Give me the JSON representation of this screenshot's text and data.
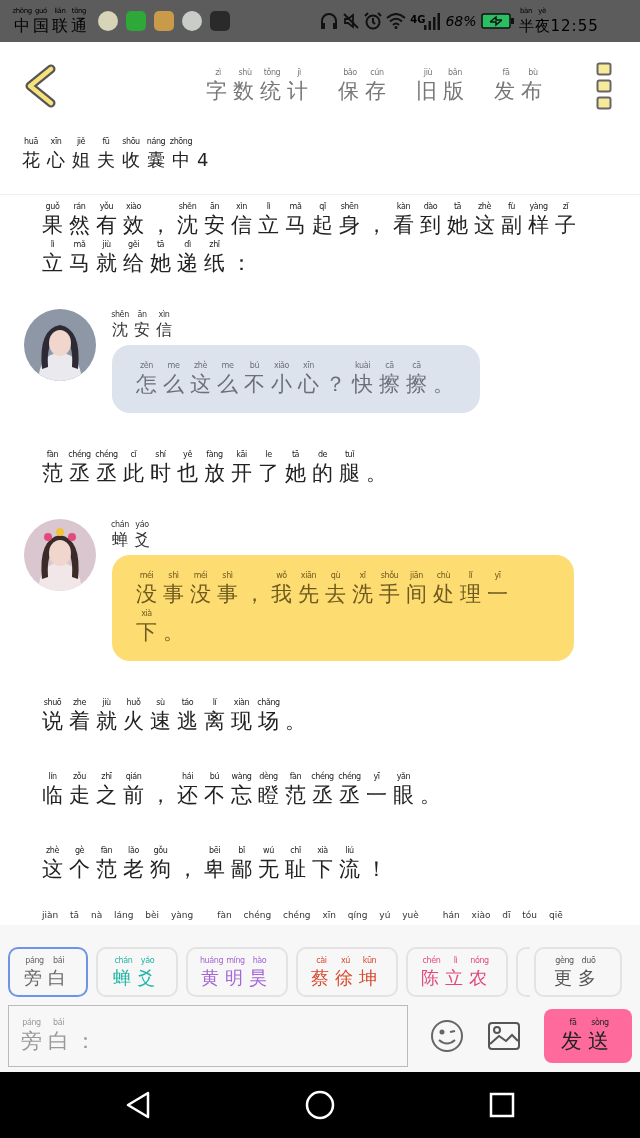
{
  "status_bar": {
    "carrier": {
      "text": "中国联通",
      "pinyin": "zhōng guó lián tōng"
    },
    "network": "4G",
    "battery": "68%",
    "time": {
      "text": "半夜12:55",
      "pinyin": "bàn yè"
    }
  },
  "header": {
    "actions": [
      {
        "text": "字数统计",
        "pinyin": "zì shù tǒng jì"
      },
      {
        "text": "保存",
        "pinyin": "bǎo cún"
      },
      {
        "text": "旧版",
        "pinyin": "jiù bǎn"
      },
      {
        "text": "发布",
        "pinyin": "fā bù"
      }
    ]
  },
  "title": {
    "text": "花心姐夫收囊中4",
    "pinyin": "huā xīn jiě fū shōu náng zhōng"
  },
  "story": [
    {
      "kind": "narration",
      "lines": [
        {
          "text": "果然有效，沈安信立马起身，看到她这副样子",
          "pinyin": "guǒ rán yǒu xiào shěn ān xìn lì mǎ qǐ shēn kàn dào tā zhè fù yàng zǐ"
        },
        {
          "text": "立马就给她递纸：",
          "pinyin": "lì mǎ jiù gěi tā dì zhǐ"
        }
      ]
    },
    {
      "kind": "message",
      "speaker": {
        "text": "沈安信",
        "pinyin": "shěn ān xìn"
      },
      "color": "#dde3ec",
      "lines": [
        {
          "text": "怎么这么不小心？快擦擦。",
          "pinyin": "zěn me zhè me bú xiǎo xīn kuài cā cā"
        }
      ]
    },
    {
      "kind": "narration",
      "lines": [
        {
          "text": "范丞丞此时也放开了她的腿。",
          "pinyin": "fàn chéng chéng cǐ shí yě fàng kāi le tā de tuǐ"
        }
      ]
    },
    {
      "kind": "message",
      "speaker": {
        "text": "蝉爻",
        "pinyin": "chán yáo"
      },
      "color": "#fddc72",
      "lines": [
        {
          "text": "没事没事，我先去洗手间处理一",
          "pinyin": "méi shì méi shì wǒ xiān qù xǐ shǒu jiān chù lǐ yī"
        },
        {
          "text": "下。",
          "pinyin": "xià"
        }
      ]
    },
    {
      "kind": "narration",
      "lines": [
        {
          "text": "说着就火速逃离现场。",
          "pinyin": "shuō zhe jiù huǒ sù táo lí xiàn chǎng"
        }
      ]
    },
    {
      "kind": "narration",
      "lines": [
        {
          "text": "临走之前，还不忘瞪范丞丞一眼。",
          "pinyin": "lín zǒu zhī qián hái bú wàng dèng fàn chéng chéng yī yǎn"
        }
      ]
    },
    {
      "kind": "narration",
      "lines": [
        {
          "text": "这个范老狗，卑鄙无耻下流！",
          "pinyin": "zhè gè fàn lǎo gǒu bēi bǐ wú chǐ xià liú"
        }
      ]
    },
    {
      "kind": "pinyin_only",
      "groups": [
        "jiàn tā nà láng bèi yàng",
        "fàn chéng chéng xīn qíng yú yuè",
        "hán xiào dī tóu qiē"
      ]
    }
  ],
  "speakers": [
    {
      "text": "旁白",
      "pinyin": "páng bái",
      "color": "#666666",
      "selected": true
    },
    {
      "text": "蝉爻",
      "pinyin": "chán yáo",
      "color": "#1fb5a6",
      "selected": false
    },
    {
      "text": "黄明昊",
      "pinyin": "huáng míng hào",
      "color": "#a565d6",
      "selected": false
    },
    {
      "text": "蔡徐坤",
      "pinyin": "cài xú kūn",
      "color": "#d8492d",
      "selected": false
    },
    {
      "text": "陈立农",
      "pinyin": "chén lì nóng",
      "color": "#e2497e",
      "selected": false
    }
  ],
  "more": {
    "text": "更多",
    "pinyin": "gèng duō"
  },
  "composer": {
    "prompt": {
      "text": "旁白：",
      "pinyin": "páng bái"
    },
    "send": {
      "text": "发送",
      "pinyin": "fā sòng"
    }
  }
}
